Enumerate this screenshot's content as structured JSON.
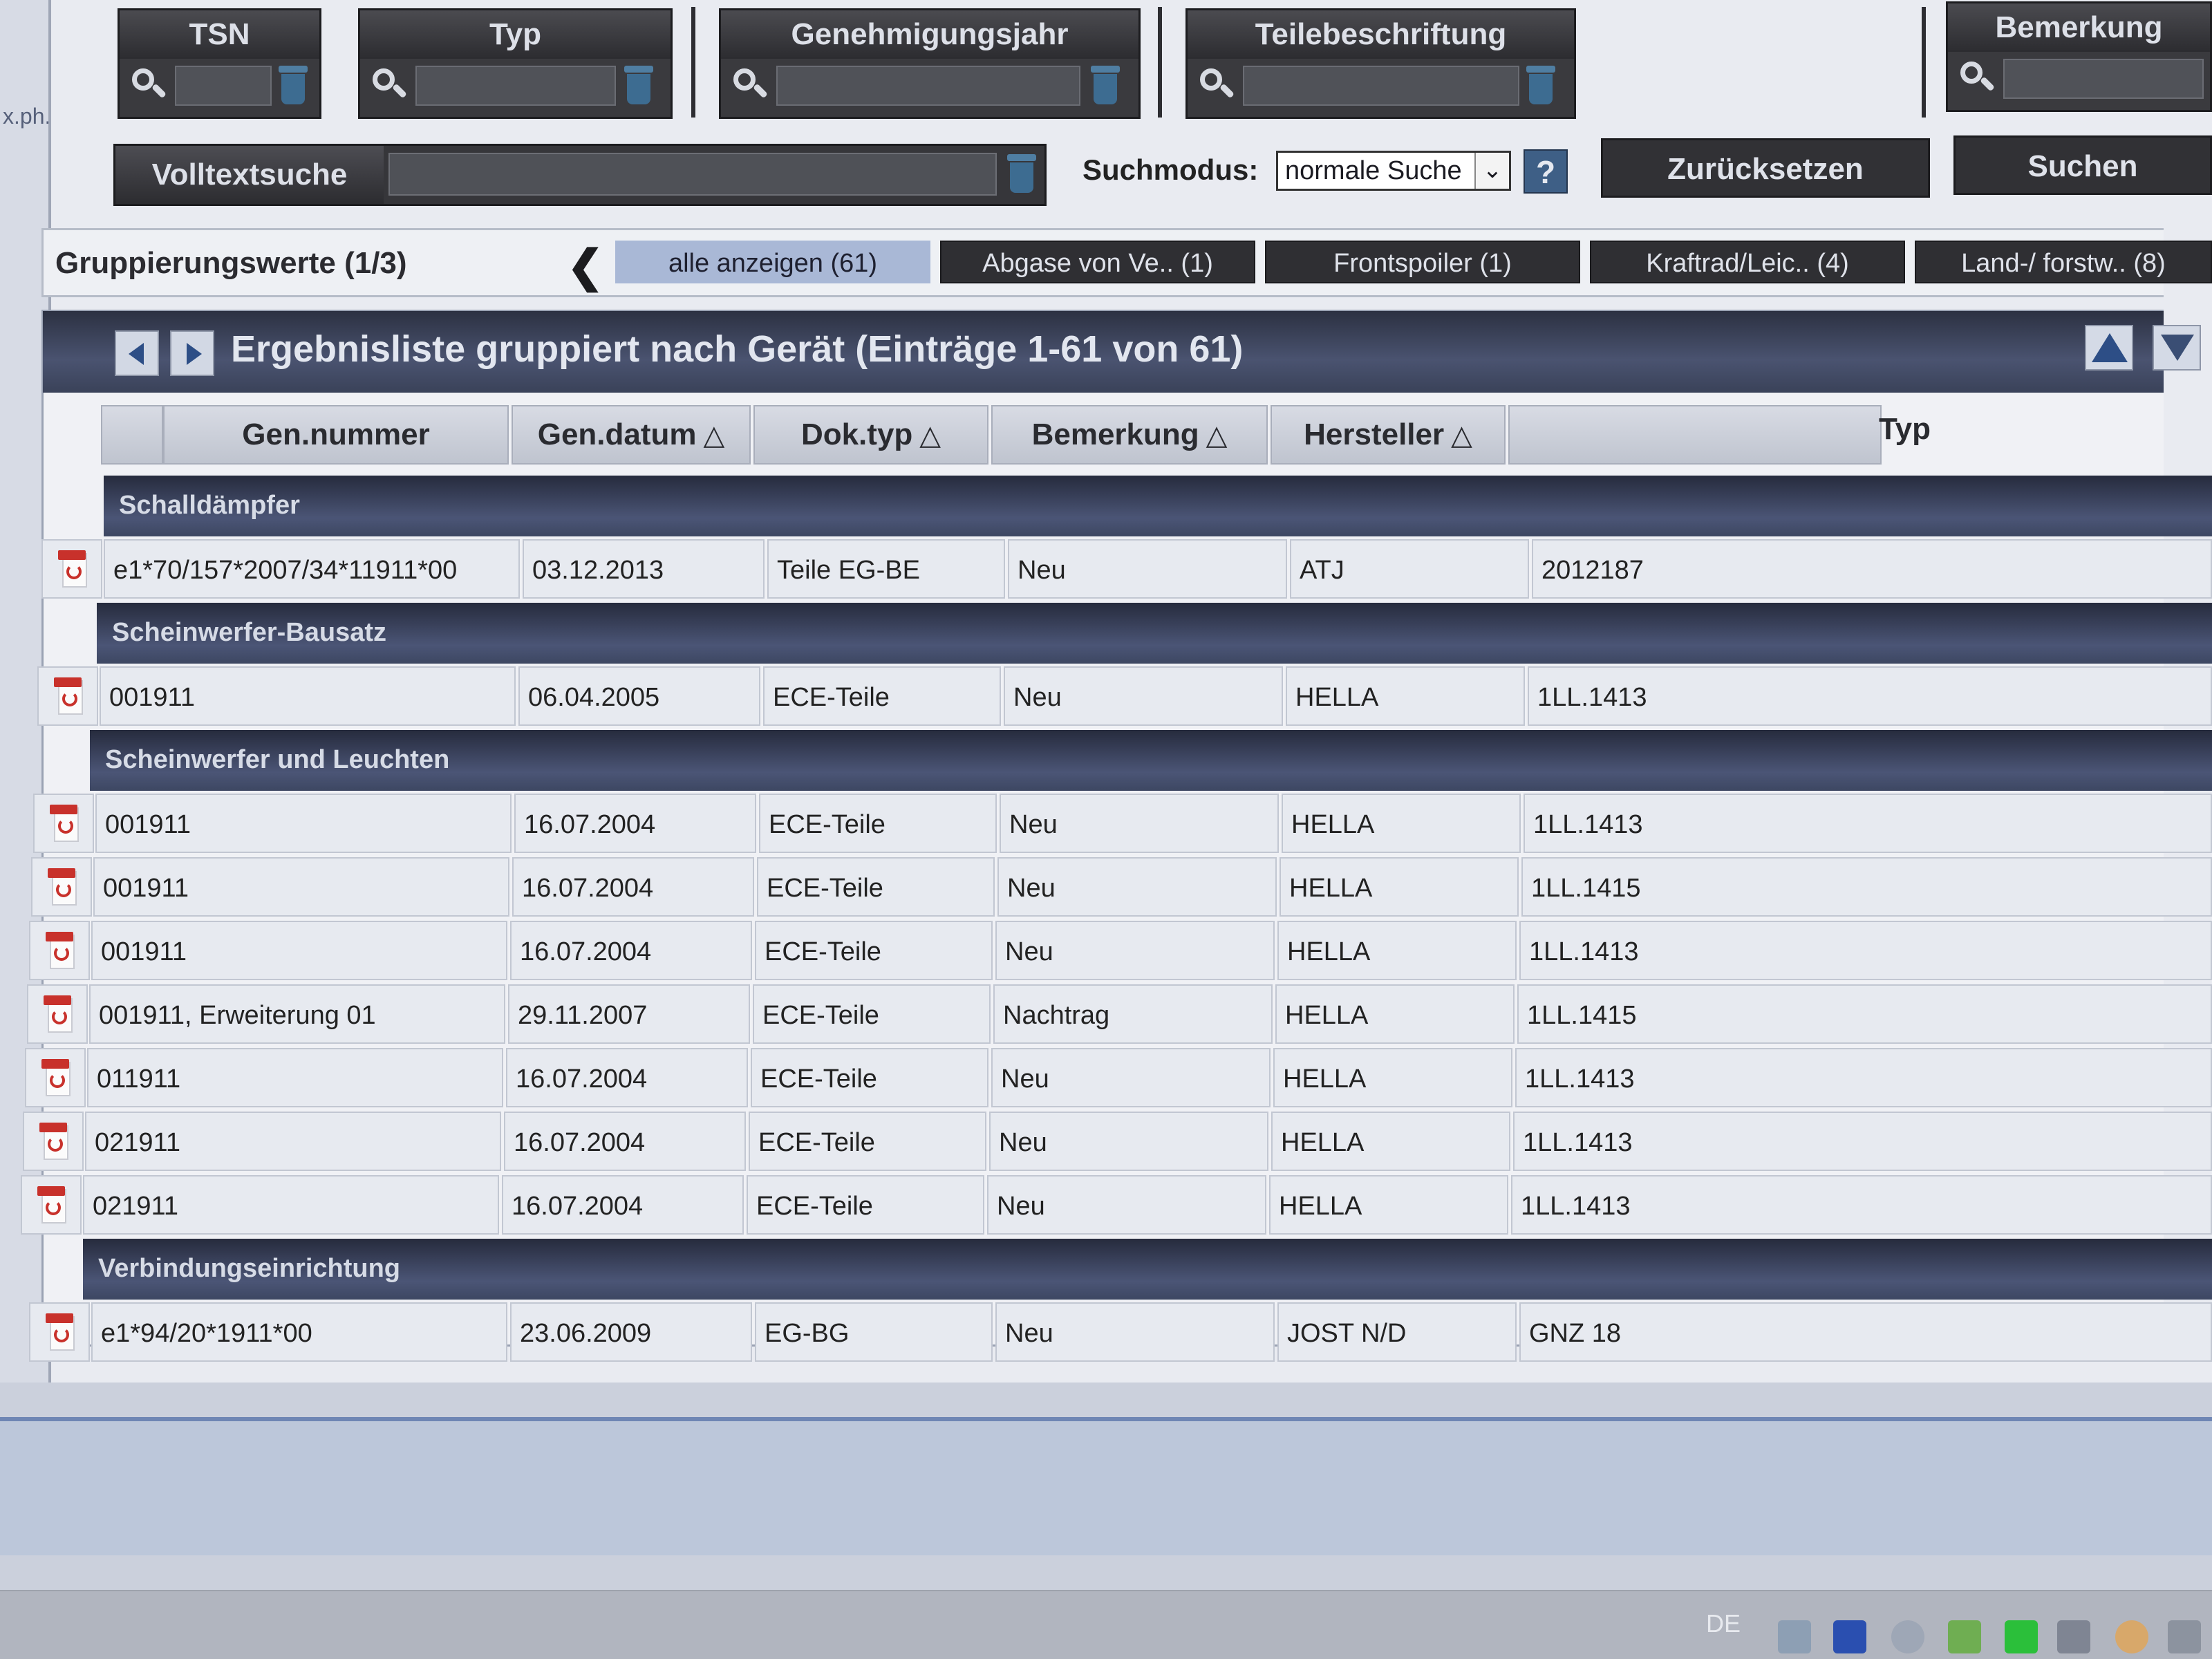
{
  "side": {
    "text": "x.ph..."
  },
  "filters": [
    {
      "label": "TSN",
      "value": ""
    },
    {
      "label": "Typ",
      "value": ""
    },
    {
      "label": "Genehmigungsjahr",
      "value": ""
    },
    {
      "label": "Teilebeschriftung",
      "value": ""
    },
    {
      "label": "Bemerkung",
      "value": ""
    }
  ],
  "fulltext": {
    "label": "Volltextsuche",
    "value": ""
  },
  "searchmode": {
    "label": "Suchmodus:",
    "selected": "normale Suche",
    "help": "?"
  },
  "buttons": {
    "reset": "Zurücksetzen",
    "search": "Suchen"
  },
  "grouping": {
    "label": "Gruppierungswerte (1/3)",
    "tabs": [
      {
        "label": "alle anzeigen (61)",
        "active": true
      },
      {
        "label": "Abgase von Ve.. (1)",
        "active": false
      },
      {
        "label": "Frontspoiler (1)",
        "active": false
      },
      {
        "label": "Kraftrad/Leic.. (4)",
        "active": false
      },
      {
        "label": "Land-/ forstw.. (8)",
        "active": false
      }
    ]
  },
  "results": {
    "title": "Ergebnisliste gruppiert nach Gerät (Einträge 1-61 von 61)",
    "columns": {
      "gen_nummer": "Gen.nummer",
      "gen_datum": "Gen.datum",
      "dok_typ": "Dok.typ",
      "bemerkung": "Bemerkung",
      "hersteller": "Hersteller",
      "typ": "Typ",
      "sort_arrow": "△"
    },
    "groups": [
      {
        "name": "Schalldämpfer",
        "rows": [
          {
            "nr": "e1*70/157*2007/34*11911*00",
            "datum": "03.12.2013",
            "dok": "Teile EG-BE",
            "bem": "Neu",
            "hersteller": "ATJ",
            "typ": "2012187"
          }
        ]
      },
      {
        "name": "Scheinwerfer-Bausatz",
        "rows": [
          {
            "nr": "001911",
            "datum": "06.04.2005",
            "dok": "ECE-Teile",
            "bem": "Neu",
            "hersteller": "HELLA",
            "typ": "1LL.1413"
          }
        ]
      },
      {
        "name": "Scheinwerfer und Leuchten",
        "rows": [
          {
            "nr": "001911",
            "datum": "16.07.2004",
            "dok": "ECE-Teile",
            "bem": "Neu",
            "hersteller": "HELLA",
            "typ": "1LL.1413"
          },
          {
            "nr": "001911",
            "datum": "16.07.2004",
            "dok": "ECE-Teile",
            "bem": "Neu",
            "hersteller": "HELLA",
            "typ": "1LL.1415"
          },
          {
            "nr": "001911",
            "datum": "16.07.2004",
            "dok": "ECE-Teile",
            "bem": "Neu",
            "hersteller": "HELLA",
            "typ": "1LL.1413"
          },
          {
            "nr": "001911, Erweiterung 01",
            "datum": "29.11.2007",
            "dok": "ECE-Teile",
            "bem": "Nachtrag",
            "hersteller": "HELLA",
            "typ": "1LL.1415"
          },
          {
            "nr": "011911",
            "datum": "16.07.2004",
            "dok": "ECE-Teile",
            "bem": "Neu",
            "hersteller": "HELLA",
            "typ": "1LL.1413"
          },
          {
            "nr": "021911",
            "datum": "16.07.2004",
            "dok": "ECE-Teile",
            "bem": "Neu",
            "hersteller": "HELLA",
            "typ": "1LL.1413"
          },
          {
            "nr": "021911",
            "datum": "16.07.2004",
            "dok": "ECE-Teile",
            "bem": "Neu",
            "hersteller": "HELLA",
            "typ": "1LL.1413"
          }
        ]
      },
      {
        "name": "Verbindungseinrichtung",
        "rows": [
          {
            "nr": "e1*94/20*1911*00",
            "datum": "23.06.2009",
            "dok": "EG-BG",
            "bem": "Neu",
            "hersteller": "JOST N/D",
            "typ": "GNZ 18"
          }
        ]
      }
    ]
  },
  "taskbar": {
    "lang": "DE"
  },
  "colors": {
    "accent": "#a9b8d6",
    "header_dark": "#313135",
    "group_bar": "#3d4762",
    "pdf_red": "#c8312b"
  }
}
